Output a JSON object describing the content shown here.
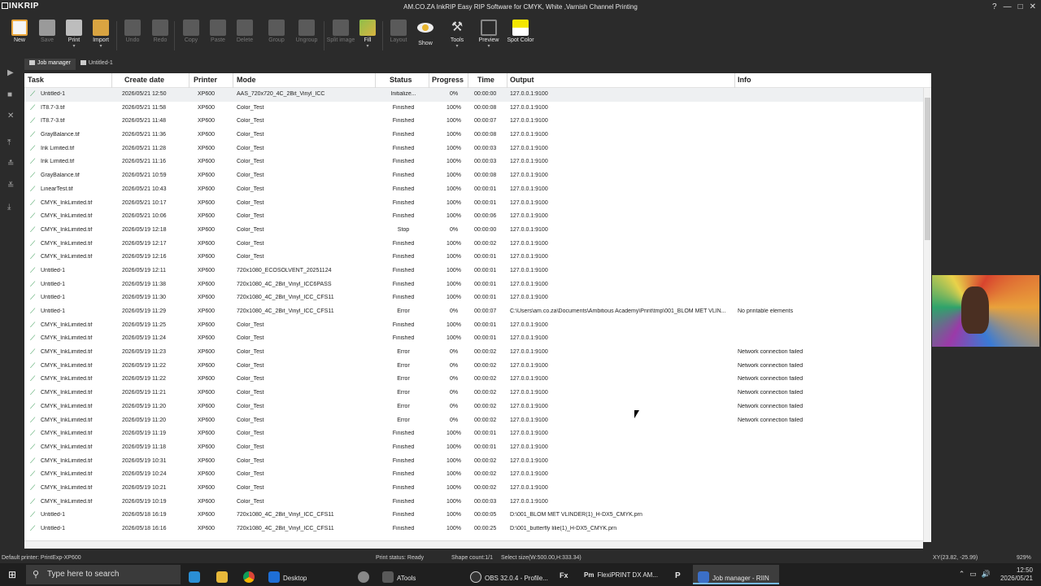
{
  "app": {
    "logo": "INKRIP",
    "window_title": "AM.CO.ZA InkRIP Easy RIP Software for CMYK, White ,Varnish Channel Printing"
  },
  "toolbar": [
    {
      "label": "New",
      "icon": "new-icon",
      "enabled": true
    },
    {
      "label": "Save",
      "icon": "save-icon",
      "enabled": false
    },
    {
      "label": "Print",
      "icon": "print-icon",
      "enabled": true,
      "dropdown": true
    },
    {
      "label": "Import",
      "icon": "import-icon",
      "enabled": true,
      "dropdown": true
    },
    {
      "label": "Undo",
      "icon": "undo-icon",
      "enabled": false
    },
    {
      "label": "Redo",
      "icon": "redo-icon",
      "enabled": false
    },
    {
      "label": "Copy",
      "icon": "copy-icon",
      "enabled": false
    },
    {
      "label": "Paste",
      "icon": "paste-icon",
      "enabled": false
    },
    {
      "label": "Delete",
      "icon": "delete-icon",
      "enabled": false
    },
    {
      "label": "Group",
      "icon": "group-icon",
      "enabled": false
    },
    {
      "label": "Ungroup",
      "icon": "ungroup-icon",
      "enabled": false
    },
    {
      "label": "Split image",
      "icon": "split-image-icon",
      "enabled": false
    },
    {
      "label": "Fill",
      "icon": "fill-icon",
      "enabled": true,
      "dropdown": true
    },
    {
      "label": "Layout",
      "icon": "layout-icon",
      "enabled": false
    },
    {
      "label": "Show",
      "icon": "eye-icon",
      "enabled": true
    },
    {
      "label": "Tools",
      "icon": "wrench-icon",
      "enabled": true,
      "dropdown": true
    },
    {
      "label": "Preview",
      "icon": "preview-icon",
      "enabled": true,
      "dropdown": true
    },
    {
      "label": "Spot Color",
      "icon": "spot-color-icon",
      "enabled": true
    }
  ],
  "tabs": [
    {
      "label": "Job manager",
      "active": true
    },
    {
      "label": "Untitled-1",
      "active": false
    }
  ],
  "table": {
    "columns": [
      "Task",
      "Create date",
      "Printer",
      "Mode",
      "Status",
      "Progress",
      "Time",
      "Output",
      "Info"
    ],
    "rows": [
      [
        "Untitled-1",
        "2026/05/21 12:50",
        "XP600",
        "AAS_720x720_4C_2Bit_Vinyl_ICC",
        "Initialize...",
        "0%",
        "00:00:00",
        "127.0.0.1:9100",
        ""
      ],
      [
        "IT8.7-3.tif",
        "2026/05/21 11:58",
        "XP600",
        "Color_Test",
        "Finished",
        "100%",
        "00:00:08",
        "127.0.0.1:9100",
        ""
      ],
      [
        "IT8.7-3.tif",
        "2026/05/21 11:48",
        "XP600",
        "Color_Test",
        "Finished",
        "100%",
        "00:00:07",
        "127.0.0.1:9100",
        ""
      ],
      [
        "GrayBalance.tif",
        "2026/05/21 11:36",
        "XP600",
        "Color_Test",
        "Finished",
        "100%",
        "00:00:08",
        "127.0.0.1:9100",
        ""
      ],
      [
        "Ink Limited.tif",
        "2026/05/21 11:28",
        "XP600",
        "Color_Test",
        "Finished",
        "100%",
        "00:00:03",
        "127.0.0.1:9100",
        ""
      ],
      [
        "Ink Limited.tif",
        "2026/05/21 11:16",
        "XP600",
        "Color_Test",
        "Finished",
        "100%",
        "00:00:03",
        "127.0.0.1:9100",
        ""
      ],
      [
        "GrayBalance.tif",
        "2026/05/21 10:59",
        "XP600",
        "Color_Test",
        "Finished",
        "100%",
        "00:00:08",
        "127.0.0.1:9100",
        ""
      ],
      [
        "LinearTest.tif",
        "2026/05/21 10:43",
        "XP600",
        "Color_Test",
        "Finished",
        "100%",
        "00:00:01",
        "127.0.0.1:9100",
        ""
      ],
      [
        "CMYK_InkLimited.tif",
        "2026/05/21 10:17",
        "XP600",
        "Color_Test",
        "Finished",
        "100%",
        "00:00:01",
        "127.0.0.1:9100",
        ""
      ],
      [
        "CMYK_InkLimited.tif",
        "2026/05/21 10:06",
        "XP600",
        "Color_Test",
        "Finished",
        "100%",
        "00:00:06",
        "127.0.0.1:9100",
        ""
      ],
      [
        "CMYK_InkLimited.tif",
        "2026/05/19 12:18",
        "XP600",
        "Color_Test",
        "Stop",
        "0%",
        "00:00:00",
        "127.0.0.1:9100",
        ""
      ],
      [
        "CMYK_InkLimited.tif",
        "2026/05/19 12:17",
        "XP600",
        "Color_Test",
        "Finished",
        "100%",
        "00:00:02",
        "127.0.0.1:9100",
        ""
      ],
      [
        "CMYK_InkLimited.tif",
        "2026/05/19 12:16",
        "XP600",
        "Color_Test",
        "Finished",
        "100%",
        "00:00:01",
        "127.0.0.1:9100",
        ""
      ],
      [
        "Untitled-1",
        "2026/05/19 12:11",
        "XP600",
        "720x1080_ECOSOLVENT_20251124",
        "Finished",
        "100%",
        "00:00:01",
        "127.0.0.1:9100",
        ""
      ],
      [
        "Untitled-1",
        "2026/05/19 11:38",
        "XP600",
        "720x1080_4C_2Bit_Vinyl_ICC6PASS",
        "Finished",
        "100%",
        "00:00:01",
        "127.0.0.1:9100",
        ""
      ],
      [
        "Untitled-1",
        "2026/05/19 11:30",
        "XP600",
        "720x1080_4C_2Bit_Vinyl_ICC_CFS11",
        "Finished",
        "100%",
        "00:00:01",
        "127.0.0.1:9100",
        ""
      ],
      [
        "Untitled-1",
        "2026/05/19 11:29",
        "XP600",
        "720x1080_4C_2Bit_Vinyl_ICC_CFS11",
        "Error",
        "0%",
        "00:00:07",
        "C:\\Users\\am.co.za\\Documents\\Ambitious Academy\\Print\\tmp\\001_BLOM MET VLIN...",
        "No printable elements"
      ],
      [
        "CMYK_InkLimited.tif",
        "2026/05/19 11:25",
        "XP600",
        "Color_Test",
        "Finished",
        "100%",
        "00:00:01",
        "127.0.0.1:9100",
        ""
      ],
      [
        "CMYK_InkLimited.tif",
        "2026/05/19 11:24",
        "XP600",
        "Color_Test",
        "Finished",
        "100%",
        "00:00:01",
        "127.0.0.1:9100",
        ""
      ],
      [
        "CMYK_InkLimited.tif",
        "2026/05/19 11:23",
        "XP600",
        "Color_Test",
        "Error",
        "0%",
        "00:00:02",
        "127.0.0.1:9100",
        "Network connection failed"
      ],
      [
        "CMYK_InkLimited.tif",
        "2026/05/19 11:22",
        "XP600",
        "Color_Test",
        "Error",
        "0%",
        "00:00:02",
        "127.0.0.1:9100",
        "Network connection failed"
      ],
      [
        "CMYK_InkLimited.tif",
        "2026/05/19 11:22",
        "XP600",
        "Color_Test",
        "Error",
        "0%",
        "00:00:02",
        "127.0.0.1:9100",
        "Network connection failed"
      ],
      [
        "CMYK_InkLimited.tif",
        "2026/05/19 11:21",
        "XP600",
        "Color_Test",
        "Error",
        "0%",
        "00:00:02",
        "127.0.0.1:9100",
        "Network connection failed"
      ],
      [
        "CMYK_InkLimited.tif",
        "2026/05/19 11:20",
        "XP600",
        "Color_Test",
        "Error",
        "0%",
        "00:00:02",
        "127.0.0.1:9100",
        "Network connection failed"
      ],
      [
        "CMYK_InkLimited.tif",
        "2026/05/19 11:20",
        "XP600",
        "Color_Test",
        "Error",
        "0%",
        "00:00:02",
        "127.0.0.1:9100",
        "Network connection failed"
      ],
      [
        "CMYK_InkLimited.tif",
        "2026/05/19 11:19",
        "XP600",
        "Color_Test",
        "Finished",
        "100%",
        "00:00:01",
        "127.0.0.1:9100",
        ""
      ],
      [
        "CMYK_InkLimited.tif",
        "2026/05/19 11:18",
        "XP600",
        "Color_Test",
        "Finished",
        "100%",
        "00:00:01",
        "127.0.0.1:9100",
        ""
      ],
      [
        "CMYK_InkLimited.tif",
        "2026/05/19 10:31",
        "XP600",
        "Color_Test",
        "Finished",
        "100%",
        "00:00:02",
        "127.0.0.1:9100",
        ""
      ],
      [
        "CMYK_InkLimited.tif",
        "2026/05/19 10:24",
        "XP600",
        "Color_Test",
        "Finished",
        "100%",
        "00:00:02",
        "127.0.0.1:9100",
        ""
      ],
      [
        "CMYK_InkLimited.tif",
        "2026/05/19 10:21",
        "XP600",
        "Color_Test",
        "Finished",
        "100%",
        "00:00:02",
        "127.0.0.1:9100",
        ""
      ],
      [
        "CMYK_InkLimited.tif",
        "2026/05/19 10:19",
        "XP600",
        "Color_Test",
        "Finished",
        "100%",
        "00:00:03",
        "127.0.0.1:9100",
        ""
      ],
      [
        "Untitled-1",
        "2026/05/18 16:19",
        "XP600",
        "720x1080_4C_2Bit_Vinyl_ICC_CFS11",
        "Finished",
        "100%",
        "00:00:05",
        "D:\\001_BLOM MET VLINDER(1)_H-DX5_CMYK.prn",
        ""
      ],
      [
        "Untitled-1",
        "2026/05/18 16:16",
        "XP600",
        "720x1080_4C_2Bit_Vinyl_ICC_CFS11",
        "Finished",
        "100%",
        "00:00:25",
        "D:\\001_butterfly lilie(1)_H-DX5_CMYK.prn",
        ""
      ]
    ]
  },
  "status": {
    "printer": "Default printer: PrintExp-XP600",
    "print_status": "Print status: Ready",
    "shape_count": "Shape count:1/1",
    "select_size": "Select size(W:500.00,H:333.34)",
    "coords": "XY(23.82, -25.99)",
    "zoom": "929%"
  },
  "taskbar": {
    "search_placeholder": "Type here to search",
    "apps": [
      {
        "label": "",
        "icon": "edge-icon"
      },
      {
        "label": "",
        "icon": "file-explorer-icon"
      },
      {
        "label": "",
        "icon": "chrome-icon"
      },
      {
        "label": "Desktop",
        "icon": "desktop-icon"
      },
      {
        "label": "",
        "icon": "app-icon"
      },
      {
        "label": "ATools",
        "icon": "atools-icon"
      },
      {
        "label": "OBS 32.0.4 - Profile...",
        "icon": "obs-icon"
      },
      {
        "label": "Fx",
        "icon": "fx-icon"
      },
      {
        "label": "FlexiPRINT DX AM...",
        "icon": "flexiprint-icon"
      },
      {
        "label": "P",
        "icon": "p-icon"
      },
      {
        "label": "Job manager - RIIN",
        "icon": "inkrip-icon"
      }
    ],
    "time": "12:50",
    "date": "2026/05/21"
  }
}
